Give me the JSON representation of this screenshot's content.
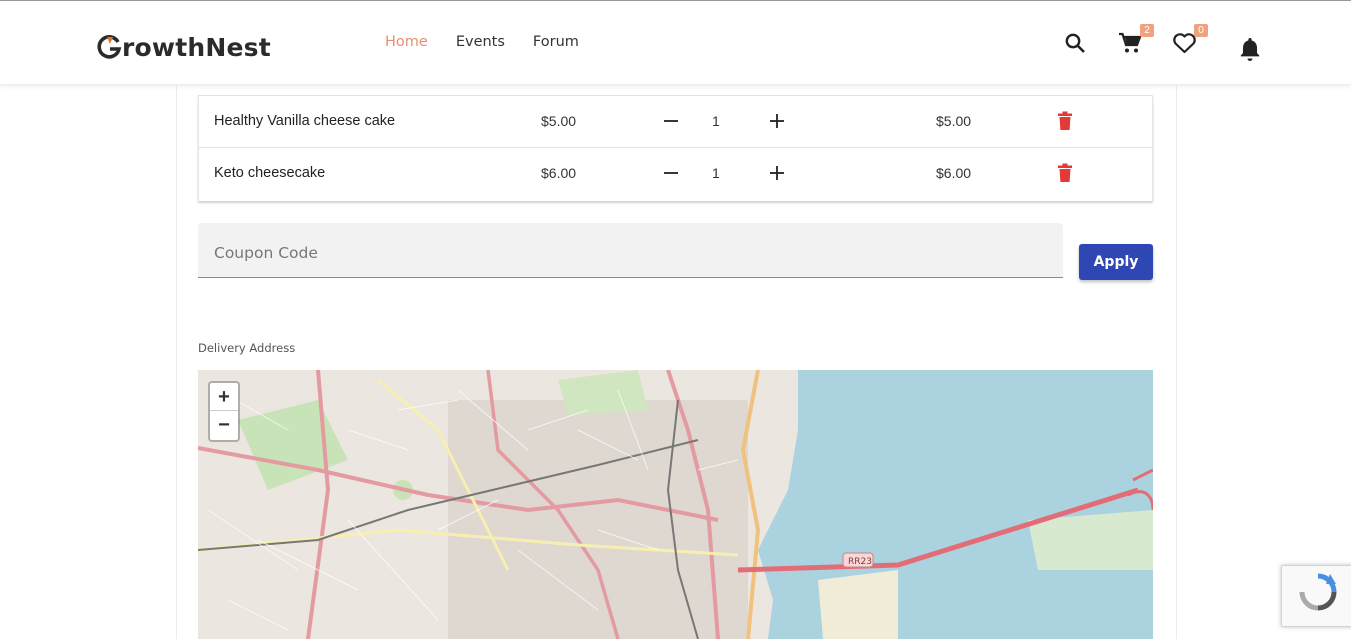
{
  "header": {
    "logo_text": "rowthNest",
    "nav": [
      {
        "label": "Home",
        "active": true
      },
      {
        "label": "Events",
        "active": false
      },
      {
        "label": "Forum",
        "active": false
      }
    ],
    "cart_count": "2",
    "wishlist_count": "0",
    "icons": [
      "search-icon",
      "cart-icon",
      "heart-icon",
      "bell-icon"
    ],
    "accent_color": "#e8906b"
  },
  "cart": {
    "items": [
      {
        "name": "Healthy Vanilla cheese cake",
        "price": "$5.00",
        "quantity": "1",
        "total": "$5.00"
      },
      {
        "name": "Keto cheesecake",
        "price": "$6.00",
        "quantity": "1",
        "total": "$6.00"
      }
    ]
  },
  "coupon": {
    "placeholder": "Coupon Code",
    "value": "",
    "apply_label": "Apply",
    "button_color": "#2f47b3"
  },
  "delivery": {
    "label": "Delivery Address",
    "zoom_in": "+",
    "zoom_out": "−",
    "road_label": "RR23"
  }
}
